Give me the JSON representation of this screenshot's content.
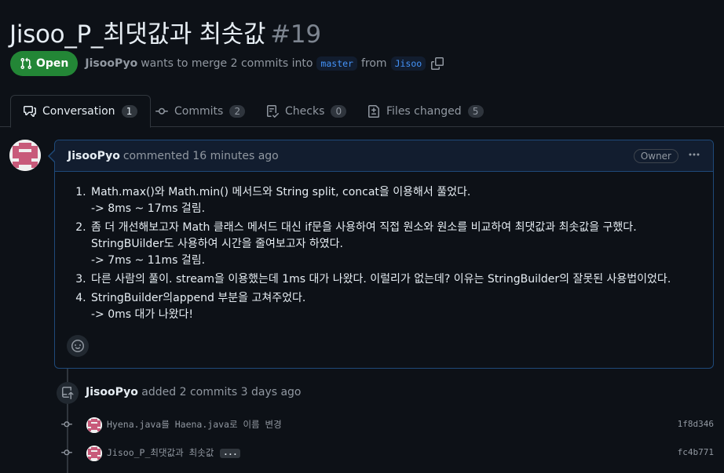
{
  "pr": {
    "title": "Jisoo_P_최댓값과 최솟값",
    "number": "#19",
    "state": "Open",
    "author": "JisooPyo",
    "merge_text": "wants to merge 2 commits into",
    "base_branch": "master",
    "from_text": "from",
    "head_branch": "Jisoo"
  },
  "tabs": [
    {
      "label": "Conversation",
      "count": "1",
      "icon": "conversation-icon"
    },
    {
      "label": "Commits",
      "count": "2",
      "icon": "commit-icon"
    },
    {
      "label": "Checks",
      "count": "0",
      "icon": "checklist-icon"
    },
    {
      "label": "Files changed",
      "count": "5",
      "icon": "file-diff-icon"
    }
  ],
  "comment": {
    "author": "JisooPyo",
    "action": "commented 16 minutes ago",
    "badge": "Owner",
    "items": [
      {
        "line1": "Math.max()와 Math.min() 메서드와 String split, concat을 이용해서 풀었다.",
        "line2": "-> 8ms ~ 17ms 걸림.",
        "line3": ""
      },
      {
        "line1": "좀 더 개선해보고자 Math 클래스 메서드 대신 if문을 사용하여 직접 원소와 원소를 비교하여 최댓값과 최솟값을 구했다.",
        "line2": "StringBUilder도 사용하여 시간을 줄여보고자 하였다.",
        "line3": "-> 7ms ~ 11ms 걸림."
      },
      {
        "line1": "다른 사람의 풀이. stream을 이용했는데 1ms 대가 나왔다. 이럴리가 없는데? 이유는 StringBuilder의 잘못된 사용법이었다.",
        "line2": "",
        "line3": ""
      },
      {
        "line1": "StringBuilder의append 부분을 고쳐주었다.",
        "line2": "-> 0ms 대가 나왔다!",
        "line3": ""
      }
    ]
  },
  "push_event": {
    "author": "JisooPyo",
    "text": "added 2 commits 3 days ago"
  },
  "commits": [
    {
      "message": "Hyena.java를 Haena.java로 이름 변경",
      "sha": "1f8d346",
      "has_more": false
    },
    {
      "message": "Jisoo_P_최댓값과 최솟값",
      "sha": "fc4b771",
      "has_more": true,
      "more_label": "..."
    }
  ],
  "colors": {
    "open_green": "#238636",
    "link_blue": "#4493f8",
    "bg": "#0d1117"
  }
}
